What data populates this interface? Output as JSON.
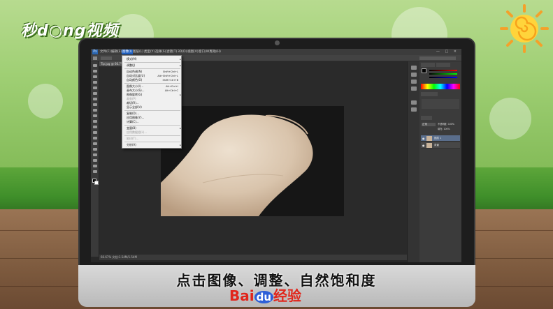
{
  "brand": {
    "logo_text": "秒d○ng视频"
  },
  "subtitle": "点击图像、调整、自然饱和度",
  "watermark": {
    "bai": "Bai",
    "du": "du",
    "rest": "经验"
  },
  "photoshop": {
    "app_icon": "Ps",
    "menubar": [
      "文件(F)",
      "编辑(E)",
      "图像(I)",
      "图层(L)",
      "类型(Y)",
      "选择(S)",
      "滤镜(T)",
      "3D(D)",
      "视图(V)",
      "窗口(W)",
      "帮助(H)"
    ],
    "active_menu": "图像(I)",
    "window_controls": "— □ ✕",
    "doc_tab": "Tip.jpg @ 66.7%",
    "status": "66.67%   文档:1.54M/1.54M",
    "image_menu": [
      {
        "label": "模式(M)",
        "shortcut": "",
        "submenu": true,
        "disabled": false
      },
      {
        "sep": true
      },
      {
        "label": "调整(J)",
        "shortcut": "",
        "submenu": true,
        "disabled": false
      },
      {
        "sep": true
      },
      {
        "label": "自动色调(N)",
        "shortcut": "Shift+Ctrl+L",
        "submenu": false,
        "disabled": false
      },
      {
        "label": "自动对比度(U)",
        "shortcut": "Alt+Shift+Ctrl+L",
        "submenu": false,
        "disabled": false
      },
      {
        "label": "自动颜色(O)",
        "shortcut": "Shift+Ctrl+B",
        "submenu": false,
        "disabled": false
      },
      {
        "sep": true
      },
      {
        "label": "图像大小(I)...",
        "shortcut": "Alt+Ctrl+I",
        "submenu": false,
        "disabled": false
      },
      {
        "label": "画布大小(S)...",
        "shortcut": "Alt+Ctrl+C",
        "submenu": false,
        "disabled": false
      },
      {
        "label": "图像旋转(G)",
        "shortcut": "",
        "submenu": true,
        "disabled": false
      },
      {
        "label": "裁剪(P)",
        "shortcut": "",
        "submenu": false,
        "disabled": true
      },
      {
        "label": "裁切(R)...",
        "shortcut": "",
        "submenu": false,
        "disabled": false
      },
      {
        "label": "显示全部(V)",
        "shortcut": "",
        "submenu": false,
        "disabled": false
      },
      {
        "sep": true
      },
      {
        "label": "复制(D)...",
        "shortcut": "",
        "submenu": false,
        "disabled": false
      },
      {
        "label": "应用图像(Y)...",
        "shortcut": "",
        "submenu": false,
        "disabled": false
      },
      {
        "label": "计算(C)...",
        "shortcut": "",
        "submenu": false,
        "disabled": false
      },
      {
        "sep": true
      },
      {
        "label": "变量(B)",
        "shortcut": "",
        "submenu": true,
        "disabled": false
      },
      {
        "label": "应用数据组(L)...",
        "shortcut": "",
        "submenu": false,
        "disabled": true
      },
      {
        "sep": true
      },
      {
        "label": "陷印(T)...",
        "shortcut": "",
        "submenu": false,
        "disabled": true
      },
      {
        "sep": true
      },
      {
        "label": "分析(A)",
        "shortcut": "",
        "submenu": true,
        "disabled": false
      }
    ],
    "layers": [
      {
        "name": "图层 1",
        "selected": true
      },
      {
        "name": "背景",
        "selected": false
      }
    ],
    "layer_opts": {
      "mode": "正常",
      "opacity": "不透明度: 100%",
      "fill": "填充: 100%"
    }
  }
}
